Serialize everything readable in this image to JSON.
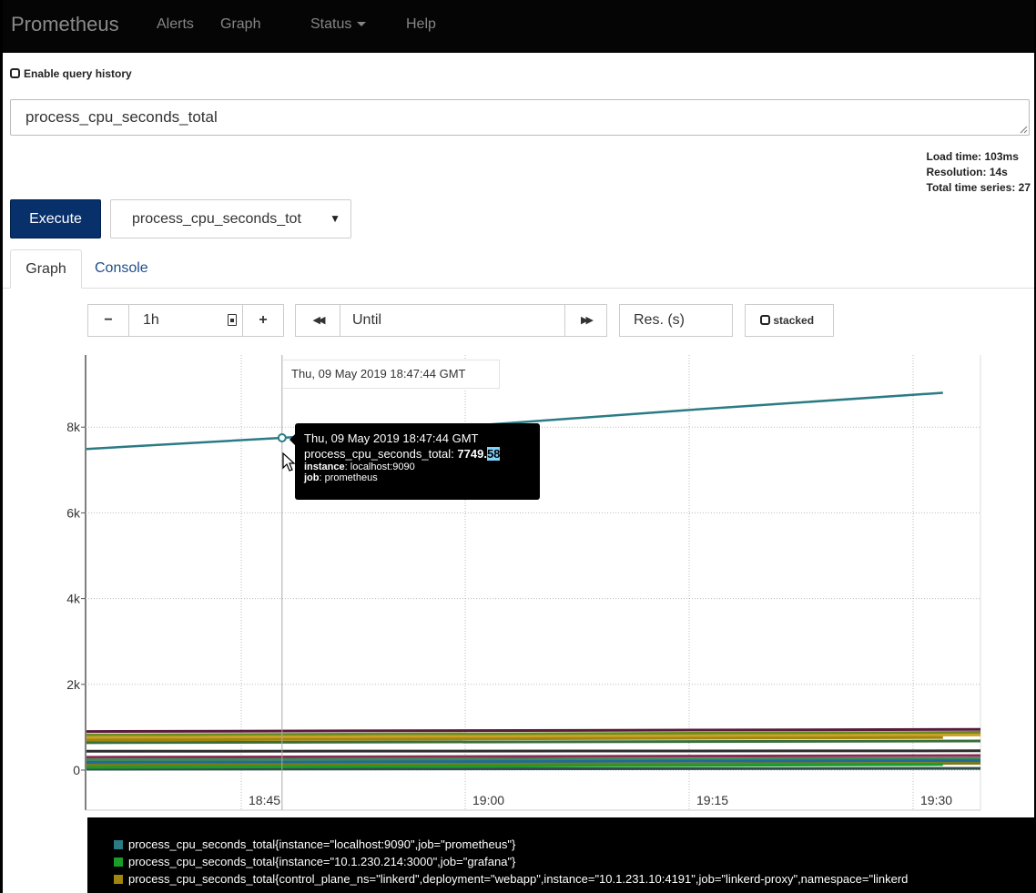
{
  "navbar": {
    "brand": "Prometheus",
    "items": [
      "Alerts",
      "Graph",
      "Status",
      "Help"
    ]
  },
  "query_history": {
    "label": "Enable query history",
    "checked": false
  },
  "expression": {
    "value": "process_cpu_seconds_total"
  },
  "stats": {
    "load_time": "Load time: 103ms",
    "resolution": "Resolution: 14s",
    "total_series": "Total time series: 27"
  },
  "execute_label": "Execute",
  "metric_select": {
    "value": "process_cpu_seconds_tot",
    "arrow": "▼"
  },
  "tabs": [
    {
      "label": "Graph",
      "active": true
    },
    {
      "label": "Console",
      "active": false
    }
  ],
  "graph_controls": {
    "minus": "−",
    "range": "1h",
    "plus": "+",
    "back": "◀◀",
    "until_placeholder": "Until",
    "forward": "▶▶",
    "res_placeholder": "Res. (s)",
    "stacked_label": "stacked"
  },
  "hover_detail": "Thu, 09 May 2019 18:47:44 GMT",
  "tooltip": {
    "time": "Thu, 09 May 2019 18:47:44 GMT",
    "metric": "process_cpu_seconds_total:",
    "value_int": "7749.",
    "value_dec": "58",
    "instance_key": "instance",
    "instance_val": ": localhost:9090",
    "job_key": "job",
    "job_val": ": prometheus"
  },
  "chart_data": {
    "type": "line",
    "x_ticks": [
      "18:45",
      "19:00",
      "19:15",
      "19:30"
    ],
    "y_ticks": [
      "0",
      "2k",
      "4k",
      "6k",
      "8k"
    ],
    "ylim": [
      -1000,
      9700
    ],
    "series": [
      {
        "name": "process_cpu_seconds_total{instance=\"localhost:9090\",job=\"prometheus\"}",
        "color": "#2b7b85",
        "x": [
          "18:32",
          "18:47:44",
          "19:00",
          "19:15",
          "19:32"
        ],
        "values": [
          7490,
          7749.58,
          8020,
          8400,
          8800
        ]
      },
      {
        "name": "process_cpu_seconds_total{instance=\"10.1.230.214:3000\",job=\"grafana\"}",
        "color": "#1a9c2a",
        "x": [
          "18:32",
          "19:32"
        ],
        "values": [
          60,
          130
        ]
      },
      {
        "name": "process_cpu_seconds_total{control_plane_ns=\"linkerd\",deployment=\"webapp\",instance=\"10.1.231.10:4191\",job=\"linkerd-proxy\",namespace=\"linkerd",
        "color": "#a0860e",
        "x": [
          "18:32",
          "19:32"
        ],
        "values": [
          700,
          760
        ]
      }
    ],
    "extra_lines": [
      {
        "color": "#5a1a3a",
        "values": [
          900,
          950
        ]
      },
      {
        "color": "#6b8c1f",
        "values": [
          820,
          880
        ]
      },
      {
        "color": "#c9a227",
        "values": [
          760,
          820
        ]
      },
      {
        "color": "#3a6e3a",
        "values": [
          640,
          680
        ]
      },
      {
        "color": "#2e2e2e",
        "values": [
          440,
          450
        ]
      },
      {
        "color": "#8a2b52",
        "values": [
          300,
          340
        ]
      },
      {
        "color": "#3c8d5a",
        "values": [
          240,
          270
        ]
      },
      {
        "color": "#1e6b9a",
        "values": [
          180,
          220
        ]
      },
      {
        "color": "#7a7a1a",
        "values": [
          120,
          160
        ]
      },
      {
        "color": "#2f4f4f",
        "values": [
          20,
          40
        ]
      }
    ]
  }
}
